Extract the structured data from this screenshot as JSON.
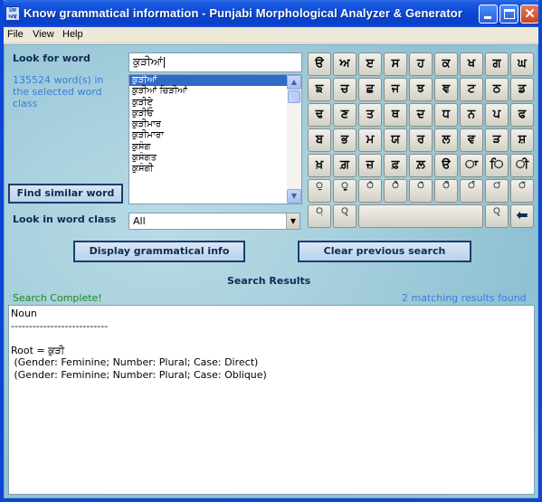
{
  "window": {
    "title": "Know grammatical  information - Punjabi Morphological Analyzer & Generator",
    "app_icon": "app-logo-icon",
    "controls": [
      "minimize-icon",
      "maximize-icon",
      "close-icon"
    ]
  },
  "menu": [
    "File",
    "View",
    "Help"
  ],
  "lookup": {
    "look_label": "Look for word",
    "word_input": "ਕੁੜੀਆਂ",
    "count_text": "135524 word(s) in the selected word class",
    "word_list": [
      "ਕੁੜੀਆਂ",
      "ਕੁੜੀਆਂ ਚਿੜੀਆਂ",
      "ਕੁੜੀਏ",
      "ਕੁੜੀਓ",
      "ਕੁੜੀਮਾਰ",
      "ਕੁੜੀਮਾਰਾ",
      "ਕੁਸੰਗ",
      "ਕੁਸੰਗਤ",
      "ਕੁਸੰਗੀ"
    ],
    "selected_index": 0,
    "similar_button": "Find similar word",
    "class_label": "Look in word class",
    "class_value": "All"
  },
  "keyboard": {
    "rows": [
      [
        "ੳ",
        "ਅ",
        "ੲ",
        "ਸ",
        "ਹ",
        "ਕ",
        "ਖ",
        "ਗ",
        "ਘ"
      ],
      [
        "ਙ",
        "ਚ",
        "ਛ",
        "ਜ",
        "ਝ",
        "ਞ",
        "ਟ",
        "ਠ",
        "ਡ"
      ],
      [
        "ਢ",
        "ਣ",
        "ਤ",
        "ਥ",
        "ਦ",
        "ਧ",
        "ਨ",
        "ਪ",
        "ਫ"
      ],
      [
        "ਬ",
        "ਭ",
        "ਮ",
        "ਯ",
        "ਰ",
        "ਲ",
        "ਵ",
        "ੜ",
        "ਸ਼"
      ],
      [
        "ਖ਼",
        "ਗ਼",
        "ਜ਼",
        "ਫ਼",
        "ਲ਼",
        "ੳ",
        "ਾ",
        "ਿ",
        "ੀ"
      ],
      [
        "ੁ",
        "ੂ",
        "ੇ",
        "ੈ",
        "ੋ",
        "ੌ",
        "ੰ",
        "ਂ",
        "ੱ"
      ]
    ],
    "last_row": [
      "਼",
      "੍",
      "space",
      "ੑ",
      "enter-arrow-icon"
    ]
  },
  "actions": {
    "display_button": "Display grammatical info",
    "clear_button": "Clear previous search"
  },
  "results": {
    "title": "Search Results",
    "status": "Search Complete!",
    "count": "2 matching results found",
    "lines": [
      "Noun",
      "---------------------------",
      "",
      "Root = ਕੁੜੀ",
      " (Gender: Feminine; Number: Plural; Case: Direct)",
      " (Gender: Feminine; Number: Plural; Case: Oblique)"
    ]
  }
}
